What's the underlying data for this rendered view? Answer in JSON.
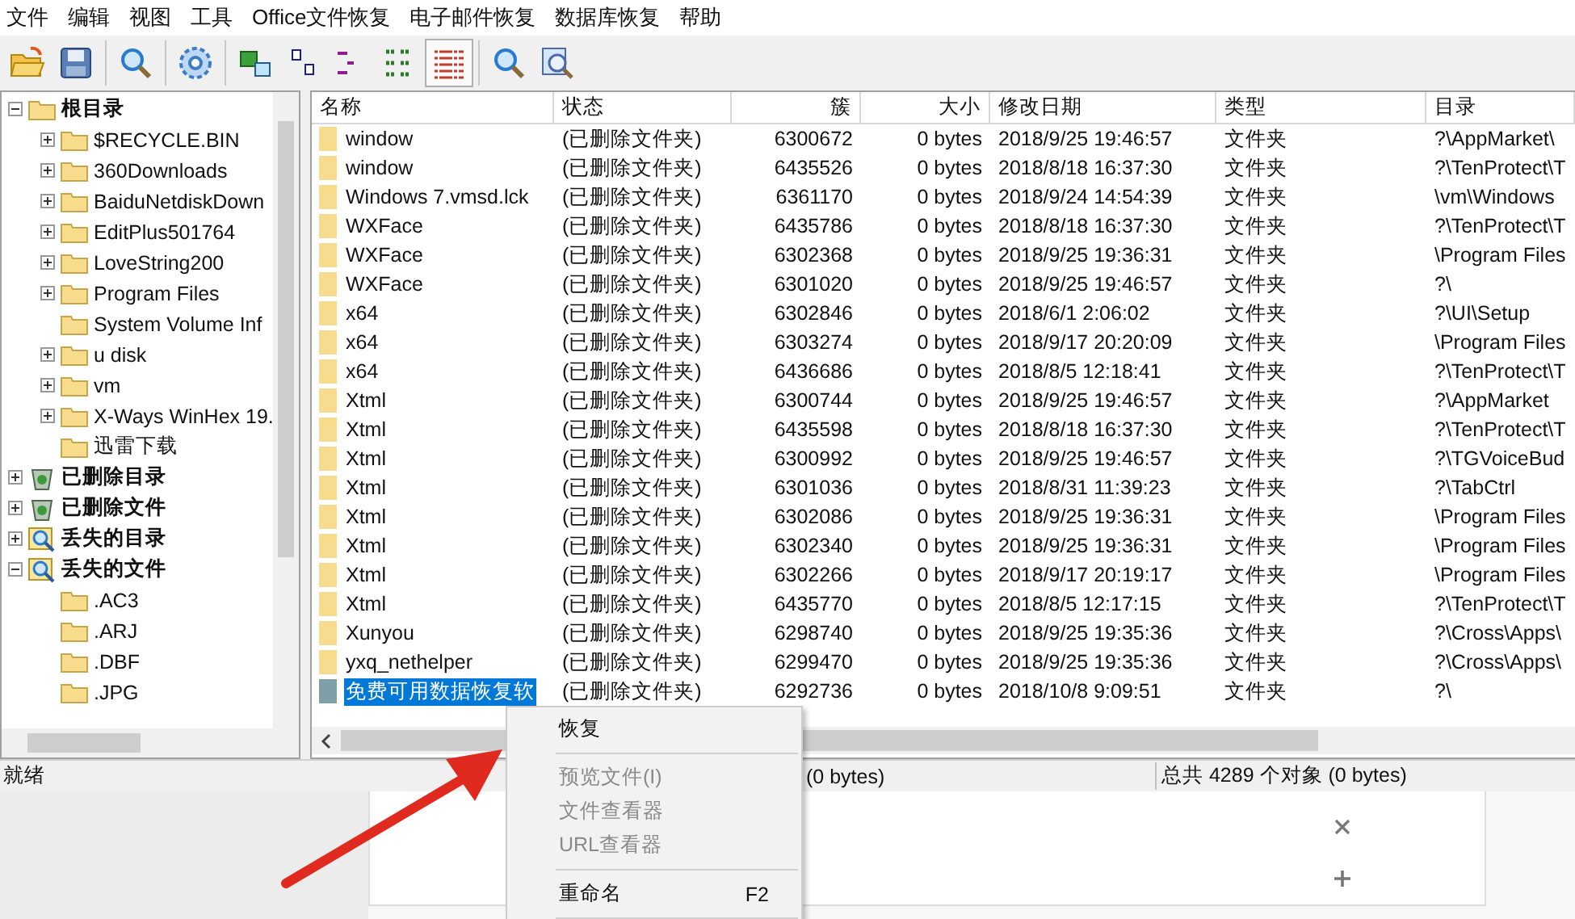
{
  "menu_bar": [
    "文件",
    "编辑",
    "视图",
    "工具",
    "Office文件恢复",
    "电子邮件恢复",
    "数据库恢复",
    "帮助"
  ],
  "toolbar": [
    {
      "kind": "open"
    },
    {
      "kind": "save"
    },
    {
      "kind": "sep"
    },
    {
      "kind": "search"
    },
    {
      "kind": "sep"
    },
    {
      "kind": "gear"
    },
    {
      "kind": "sep"
    },
    {
      "kind": "large"
    },
    {
      "kind": "small"
    },
    {
      "kind": "tree"
    },
    {
      "kind": "grid"
    },
    {
      "kind": "details",
      "selected": true
    },
    {
      "kind": "sep"
    },
    {
      "kind": "find"
    },
    {
      "kind": "compare"
    }
  ],
  "tree": [
    {
      "label": "根目录",
      "kind": "folder",
      "expandable": true,
      "expanded": true,
      "children": [
        {
          "label": "$RECYCLE.BIN",
          "kind": "folder",
          "expandable": true,
          "expanded": false
        },
        {
          "label": "360Downloads",
          "kind": "folder",
          "expandable": true,
          "expanded": false
        },
        {
          "label": "BaiduNetdiskDown",
          "kind": "folder",
          "expandable": true,
          "expanded": false
        },
        {
          "label": "EditPlus501764",
          "kind": "folder",
          "expandable": true,
          "expanded": false
        },
        {
          "label": "LoveString200",
          "kind": "folder",
          "expandable": true,
          "expanded": false
        },
        {
          "label": "Program Files",
          "kind": "folder",
          "expandable": true,
          "expanded": false
        },
        {
          "label": "System Volume Inf",
          "kind": "folder",
          "expandable": false,
          "expanded": false
        },
        {
          "label": "u disk",
          "kind": "folder",
          "expandable": true,
          "expanded": false
        },
        {
          "label": "vm",
          "kind": "folder",
          "expandable": true,
          "expanded": false
        },
        {
          "label": "X-Ways WinHex 19.",
          "kind": "folder",
          "expandable": true,
          "expanded": false
        },
        {
          "label": "迅雷下载",
          "kind": "folder",
          "expandable": false,
          "expanded": false
        }
      ]
    },
    {
      "label": "已删除目录",
      "kind": "recycle",
      "expandable": true,
      "expanded": false
    },
    {
      "label": "已删除文件",
      "kind": "recycle",
      "expandable": true,
      "expanded": false
    },
    {
      "label": "丢失的目录",
      "kind": "magnifier",
      "expandable": true,
      "expanded": false
    },
    {
      "label": "丢失的文件",
      "kind": "magnifier",
      "expandable": true,
      "expanded": true,
      "children": [
        {
          "label": ".AC3",
          "kind": "folder",
          "expandable": false,
          "expanded": false
        },
        {
          "label": ".ARJ",
          "kind": "folder",
          "expandable": false,
          "expanded": false
        },
        {
          "label": ".DBF",
          "kind": "folder",
          "expandable": false,
          "expanded": false
        },
        {
          "label": ".JPG",
          "kind": "folder",
          "expandable": false,
          "expanded": false
        }
      ]
    }
  ],
  "table": {
    "columns": [
      "名称",
      "状态",
      "簇",
      "大小",
      "修改日期",
      "类型",
      "目录"
    ],
    "rows": [
      {
        "cells": [
          "window",
          "(已删除文件夹)",
          "6300672",
          "0 bytes",
          "2018/9/25 19:46:57",
          "文件夹",
          "?\\AppMarket\\"
        ],
        "selected": false
      },
      {
        "cells": [
          "window",
          "(已删除文件夹)",
          "6435526",
          "0 bytes",
          "2018/8/18 16:37:30",
          "文件夹",
          "?\\TenProtect\\T"
        ],
        "selected": false
      },
      {
        "cells": [
          "Windows 7.vmsd.lck",
          "(已删除文件夹)",
          "6361170",
          "0 bytes",
          "2018/9/24 14:54:39",
          "文件夹",
          "\\vm\\Windows"
        ],
        "selected": false
      },
      {
        "cells": [
          "WXFace",
          "(已删除文件夹)",
          "6435786",
          "0 bytes",
          "2018/8/18 16:37:30",
          "文件夹",
          "?\\TenProtect\\T"
        ],
        "selected": false
      },
      {
        "cells": [
          "WXFace",
          "(已删除文件夹)",
          "6302368",
          "0 bytes",
          "2018/9/25 19:36:31",
          "文件夹",
          "\\Program Files"
        ],
        "selected": false
      },
      {
        "cells": [
          "WXFace",
          "(已删除文件夹)",
          "6301020",
          "0 bytes",
          "2018/9/25 19:46:57",
          "文件夹",
          "?\\"
        ],
        "selected": false
      },
      {
        "cells": [
          "x64",
          "(已删除文件夹)",
          "6302846",
          "0 bytes",
          "2018/6/1 2:06:02",
          "文件夹",
          "?\\UI\\Setup"
        ],
        "selected": false
      },
      {
        "cells": [
          "x64",
          "(已删除文件夹)",
          "6303274",
          "0 bytes",
          "2018/9/17 20:20:09",
          "文件夹",
          "\\Program Files"
        ],
        "selected": false
      },
      {
        "cells": [
          "x64",
          "(已删除文件夹)",
          "6436686",
          "0 bytes",
          "2018/8/5 12:18:41",
          "文件夹",
          "?\\TenProtect\\T"
        ],
        "selected": false
      },
      {
        "cells": [
          "Xtml",
          "(已删除文件夹)",
          "6300744",
          "0 bytes",
          "2018/9/25 19:46:57",
          "文件夹",
          "?\\AppMarket"
        ],
        "selected": false
      },
      {
        "cells": [
          "Xtml",
          "(已删除文件夹)",
          "6435598",
          "0 bytes",
          "2018/8/18 16:37:30",
          "文件夹",
          "?\\TenProtect\\T"
        ],
        "selected": false
      },
      {
        "cells": [
          "Xtml",
          "(已删除文件夹)",
          "6300992",
          "0 bytes",
          "2018/9/25 19:46:57",
          "文件夹",
          "?\\TGVoiceBud"
        ],
        "selected": false
      },
      {
        "cells": [
          "Xtml",
          "(已删除文件夹)",
          "6301036",
          "0 bytes",
          "2018/8/31 11:39:23",
          "文件夹",
          "?\\TabCtrl"
        ],
        "selected": false
      },
      {
        "cells": [
          "Xtml",
          "(已删除文件夹)",
          "6302086",
          "0 bytes",
          "2018/9/25 19:36:31",
          "文件夹",
          "\\Program Files"
        ],
        "selected": false
      },
      {
        "cells": [
          "Xtml",
          "(已删除文件夹)",
          "6302340",
          "0 bytes",
          "2018/9/25 19:36:31",
          "文件夹",
          "\\Program Files"
        ],
        "selected": false
      },
      {
        "cells": [
          "Xtml",
          "(已删除文件夹)",
          "6302266",
          "0 bytes",
          "2018/9/17 20:19:17",
          "文件夹",
          "\\Program Files"
        ],
        "selected": false
      },
      {
        "cells": [
          "Xtml",
          "(已删除文件夹)",
          "6435770",
          "0 bytes",
          "2018/8/5 12:17:15",
          "文件夹",
          "?\\TenProtect\\T"
        ],
        "selected": false
      },
      {
        "cells": [
          "Xunyou",
          "(已删除文件夹)",
          "6298740",
          "0 bytes",
          "2018/9/25 19:35:36",
          "文件夹",
          "?\\Cross\\Apps\\"
        ],
        "selected": false
      },
      {
        "cells": [
          "yxq_nethelper",
          "(已删除文件夹)",
          "6299470",
          "0 bytes",
          "2018/9/25 19:35:36",
          "文件夹",
          "?\\Cross\\Apps\\"
        ],
        "selected": false
      },
      {
        "cells": [
          "免费可用数据恢复软",
          "(已删除文件夹)",
          "6292736",
          "0 bytes",
          "2018/10/8 9:09:51",
          "文件夹",
          "?\\"
        ],
        "selected": true
      }
    ]
  },
  "status_bar": [
    "就绪",
    "(0 bytes)",
    "总共 4289 个对象 (0 bytes)"
  ],
  "context_menu": [
    {
      "kind": "item",
      "label": "恢复",
      "disabled": false
    },
    {
      "kind": "separator"
    },
    {
      "kind": "item",
      "label": "预览文件(I)",
      "disabled": true
    },
    {
      "kind": "item",
      "label": "文件查看器",
      "disabled": true
    },
    {
      "kind": "item",
      "label": "URL查看器",
      "disabled": true
    },
    {
      "kind": "separator"
    },
    {
      "kind": "item",
      "label": "重命名",
      "shortcut": "F2",
      "disabled": false
    },
    {
      "kind": "separator"
    }
  ]
}
